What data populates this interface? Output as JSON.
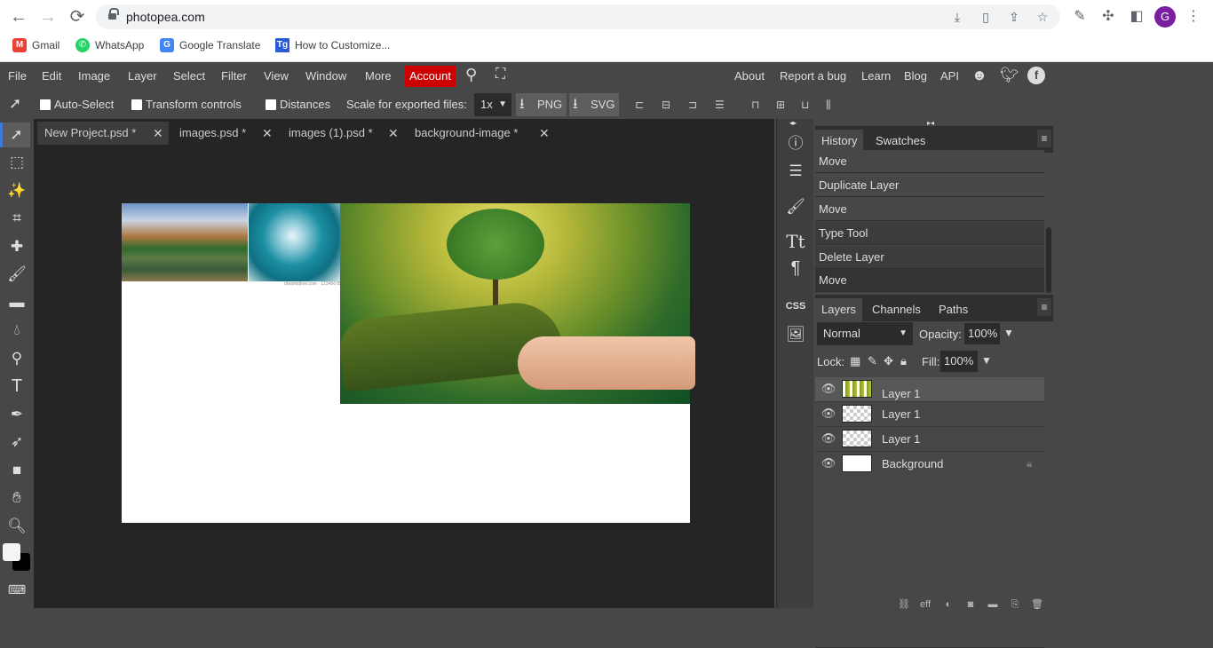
{
  "browser": {
    "url": "photopea.com",
    "nav": {
      "back": "←",
      "forward": "→",
      "reload": "⟳"
    },
    "omnibox_icons": [
      "install-icon",
      "page-icon",
      "share-icon",
      "star-icon"
    ],
    "extensions": [
      "eyedropper-icon",
      "puzzle-icon",
      "sidepanel-icon"
    ],
    "profile_initial": "G",
    "menu": "⋮",
    "bookmarks": [
      {
        "label": "Gmail",
        "icon": "M",
        "color": "#ea4335"
      },
      {
        "label": "WhatsApp",
        "icon": "✆",
        "color": "#25d366"
      },
      {
        "label": "Google Translate",
        "icon": "G",
        "color": "#4285f4"
      },
      {
        "label": "How to Customize...",
        "icon": "Tg",
        "color": "#2a5bd7"
      }
    ]
  },
  "menubar": {
    "items": [
      "File",
      "Edit",
      "Image",
      "Layer",
      "Select",
      "Filter",
      "View",
      "Window",
      "More"
    ],
    "account": "Account",
    "right_links": [
      "About",
      "Report a bug",
      "Learn",
      "Blog",
      "API"
    ],
    "accent": "#cc0000"
  },
  "toolbar": {
    "auto_select": "Auto-Select",
    "transform_controls": "Transform controls",
    "distances": "Distances",
    "scale_label": "Scale for exported files:",
    "scale_value": "1x",
    "png": "PNG",
    "svg": "SVG"
  },
  "doc_tabs": [
    {
      "label": "New Project.psd *",
      "active": true
    },
    {
      "label": "images.psd *",
      "active": false
    },
    {
      "label": "images (1).psd *",
      "active": false
    },
    {
      "label": "background-image *",
      "active": false
    }
  ],
  "canvas": {
    "caption": "dreamstime.com · 12345678"
  },
  "history_panel": {
    "tabs": [
      "History",
      "Swatches"
    ],
    "items": [
      "Move",
      "Duplicate Layer",
      "Move",
      "Type Tool",
      "Delete Layer",
      "Move"
    ]
  },
  "layers_panel": {
    "tabs": [
      "Layers",
      "Channels",
      "Paths"
    ],
    "blend_mode": "Normal",
    "opacity_label": "Opacity:",
    "opacity": "100%",
    "lock_label": "Lock:",
    "fill_label": "Fill:",
    "fill": "100%",
    "layers": [
      {
        "name": "Layer 1",
        "selected": true,
        "visible": true
      },
      {
        "name": "Layer 1",
        "selected": false,
        "visible": true
      },
      {
        "name": "Layer 1",
        "selected": false,
        "visible": true
      },
      {
        "name": "Background",
        "selected": false,
        "visible": true,
        "locked": true
      }
    ],
    "footer_icons": [
      "link-icon",
      "effects-icon",
      "adjustment-icon",
      "mask-icon",
      "folder-icon",
      "new-layer-icon",
      "trash-icon"
    ],
    "effects_label": "eff"
  },
  "side_icons": {
    "css": "CSS"
  }
}
